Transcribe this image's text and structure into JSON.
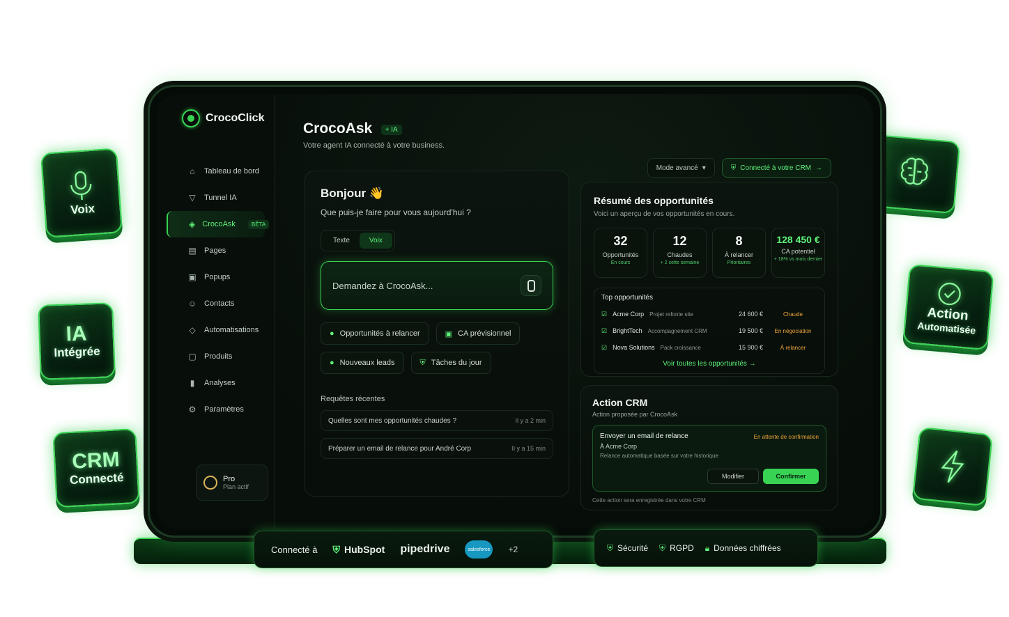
{
  "tiles": {
    "voix": "Voix",
    "ia_big": "IA",
    "ia_small": "Intégrée",
    "crm_big": "CRM",
    "crm_small": "Connecté",
    "action_big": "Action",
    "action_small": "Automatisée"
  },
  "sidebar": {
    "brand": "CrocoClick",
    "items": [
      {
        "label": "Tableau de bord",
        "icon": "home-icon"
      },
      {
        "label": "Tunnel IA",
        "icon": "funnel-icon"
      },
      {
        "label": "CrocoAsk",
        "icon": "shield-icon",
        "badge": "BÊTA"
      },
      {
        "label": "Pages",
        "icon": "page-icon"
      },
      {
        "label": "Popups",
        "icon": "popup-icon"
      },
      {
        "label": "Contacts",
        "icon": "contacts-icon"
      },
      {
        "label": "Automatisations",
        "icon": "automation-icon"
      },
      {
        "label": "Produits",
        "icon": "box-icon"
      },
      {
        "label": "Analyses",
        "icon": "chart-icon"
      },
      {
        "label": "Paramètres",
        "icon": "gear-icon"
      }
    ],
    "pro": {
      "title": "Pro",
      "plan": "Plan actif"
    }
  },
  "header": {
    "title": "CrocoAsk",
    "tag": "+ IA",
    "subtitle": "Votre agent IA connecté à votre business.",
    "mode": "Mode avancé",
    "crm": "Connecté à votre CRM"
  },
  "chat": {
    "greeting": "Bonjour 👋",
    "question": "Que puis-je faire pour vous aujourd'hui ?",
    "mode_text": "Texte",
    "mode_voice": "Voix",
    "placeholder": "Demandez à CrocoAsk...",
    "chips": [
      "Opportunités à relancer",
      "CA prévisionnel",
      "Nouveaux leads",
      "Tâches du jour"
    ],
    "recent_title": "Requêtes récentes",
    "recent": [
      {
        "text": "Quelles sont mes opportunités chaudes ?",
        "time": "Il y a 2 min"
      },
      {
        "text": "Préparer un email de relance pour André Corp",
        "time": "Il y a 15 min"
      }
    ]
  },
  "summary": {
    "title": "Résumé des opportunités",
    "subtitle": "Voici un aperçu de vos opportunités en cours.",
    "stats": [
      {
        "value": "32",
        "label": "Opportunités",
        "sub": "En cours"
      },
      {
        "value": "12",
        "label": "Chaudes",
        "sub": "+ 2 cette semaine"
      },
      {
        "value": "8",
        "label": "À relancer",
        "sub": "Prioritaires"
      },
      {
        "value": "128 450 €",
        "label": "CA potentiel",
        "sub": "+ 18% vs mois dernier"
      }
    ],
    "top_title": "Top opportunités",
    "opps": [
      {
        "name": "Acme Corp",
        "project": "Projet refonte site",
        "amount": "24 600 €",
        "status": "Chaude"
      },
      {
        "name": "BrightTech",
        "project": "Accompagnement CRM",
        "amount": "19 500 €",
        "status": "En négociation"
      },
      {
        "name": "Nova Solutions",
        "project": "Pack croissance",
        "amount": "15 900 €",
        "status": "À relancer"
      }
    ],
    "see_all": "Voir toutes les opportunités →"
  },
  "action": {
    "title": "Action CRM",
    "subtitle": "Action proposée par CrocoAsk",
    "task": "Envoyer un email de relance",
    "to": "À Acme Corp",
    "desc": "Relance automatique basée sur votre historique",
    "pending": "En attente de confirmation",
    "modify": "Modifier",
    "confirm": "Confirmer",
    "note": "Cette action sera enregistrée dans votre CRM"
  },
  "bottom": {
    "connected": "Connecté à",
    "hubspot": "HubSpot",
    "pipedrive": "pipedrive",
    "salesforce": "salesforce",
    "more": "+2",
    "security": "Sécurité",
    "rgpd": "RGPD",
    "encrypted": "Données chiffrées"
  }
}
